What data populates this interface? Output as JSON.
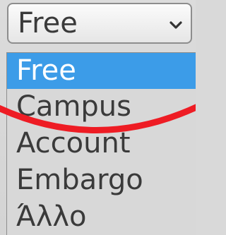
{
  "select": {
    "value": "Free",
    "icon": "chevron-down-icon"
  },
  "options": [
    {
      "label": "Free",
      "selected": true
    },
    {
      "label": "Campus",
      "selected": false
    },
    {
      "label": "Account",
      "selected": false
    },
    {
      "label": "Embargo",
      "selected": false
    },
    {
      "label": "Άλλο",
      "selected": false
    }
  ],
  "colors": {
    "selected_bg": "#3c9ce8",
    "annotation_red": "#ee1c24"
  }
}
